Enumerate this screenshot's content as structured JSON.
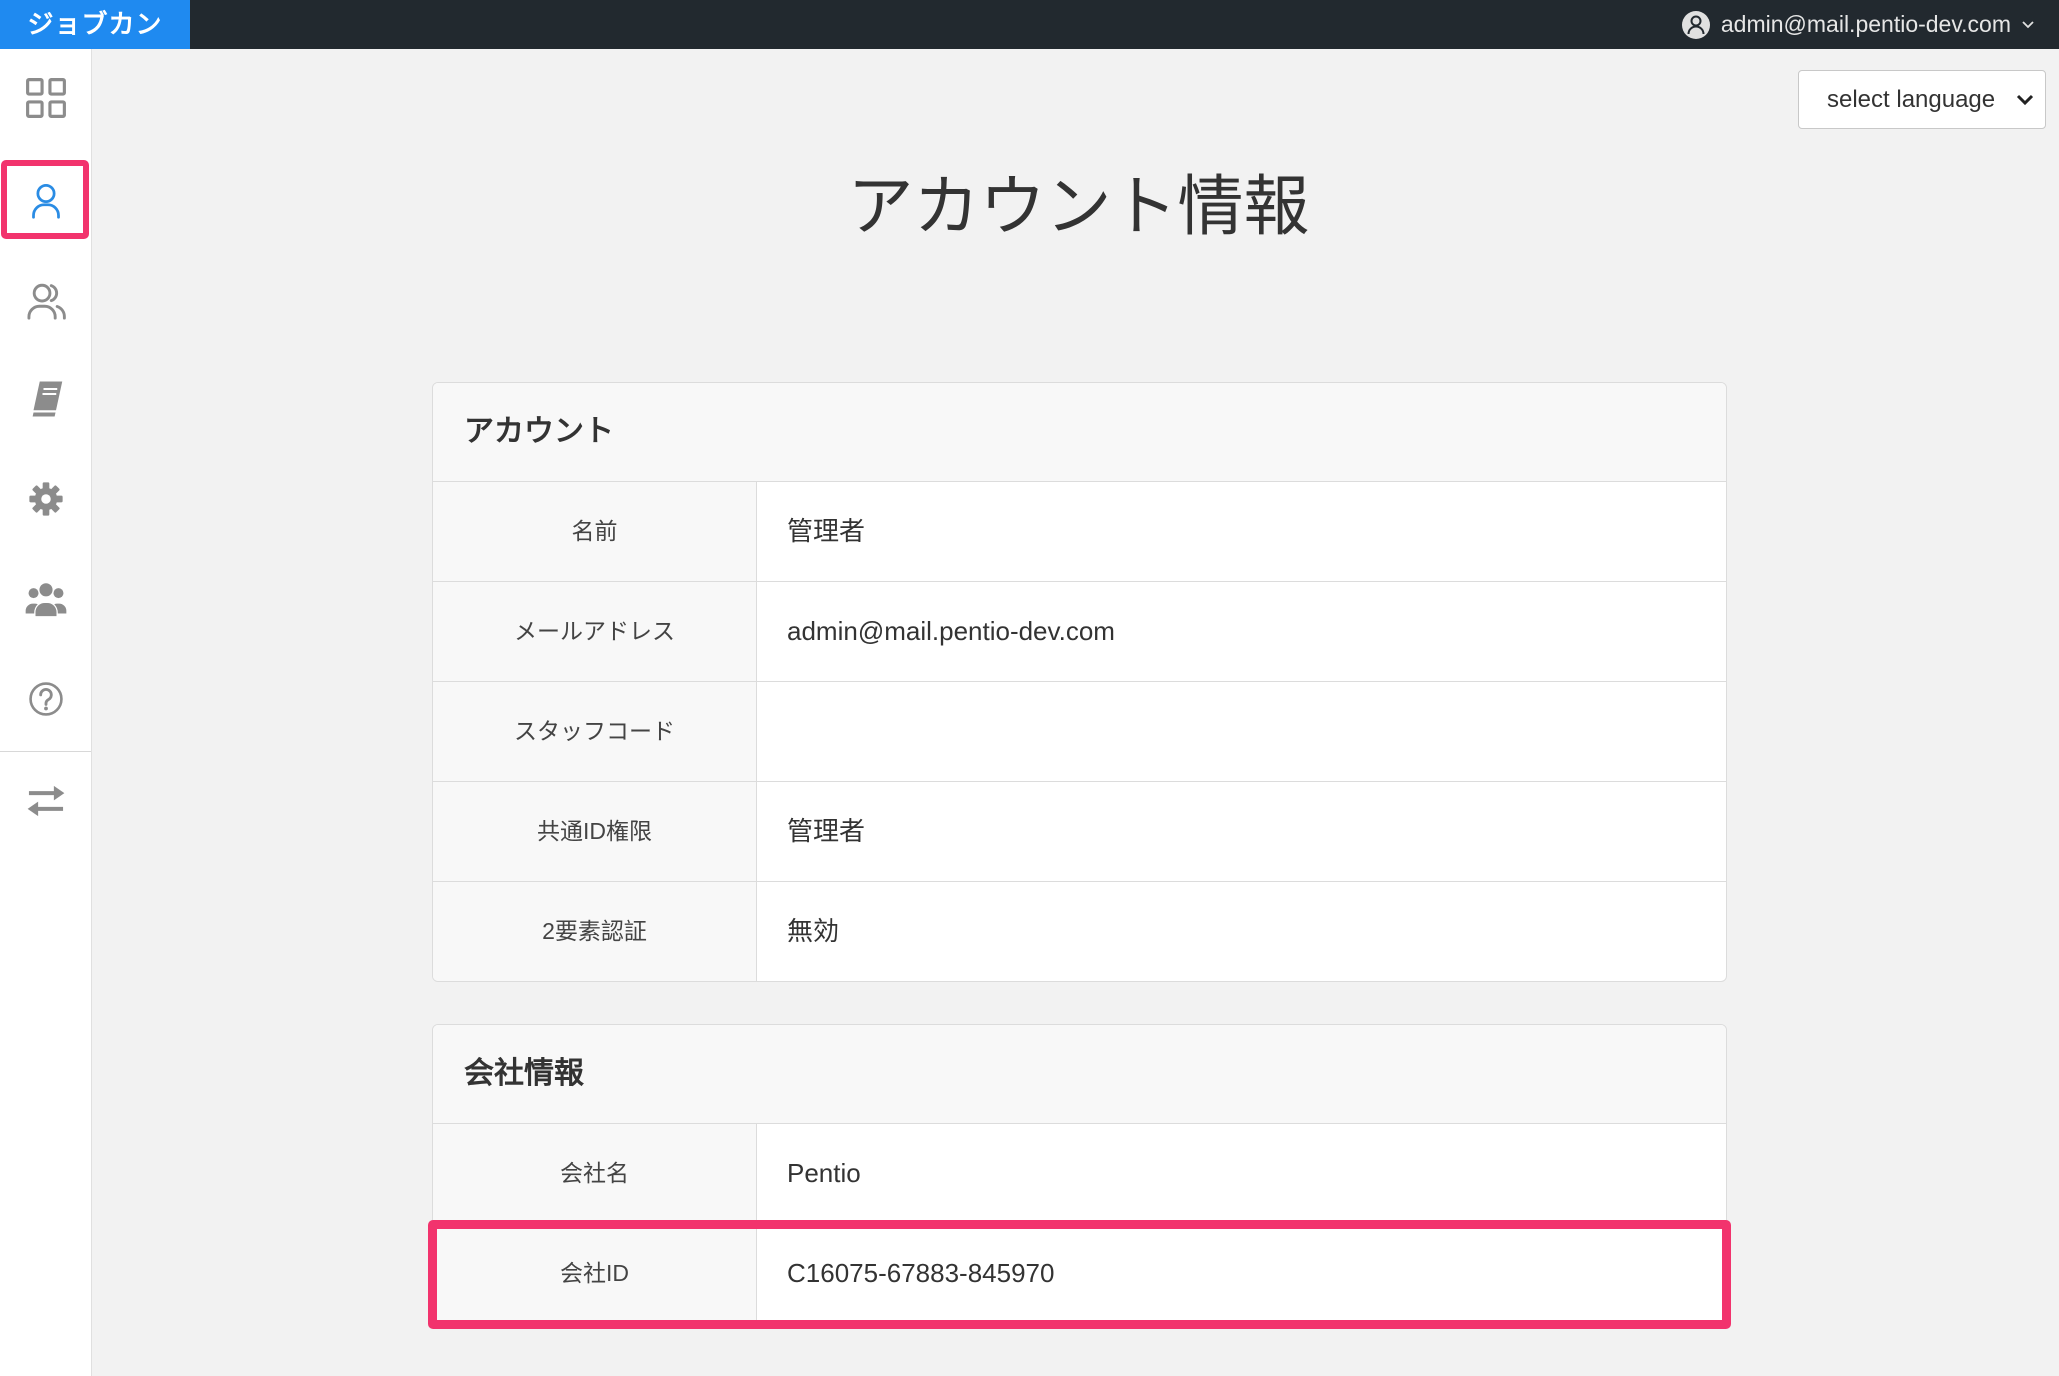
{
  "topbar": {
    "logo": "ジョブカン",
    "user_email": "admin@mail.pentio-dev.com",
    "avatar_icon": "user-circle-icon",
    "menu_icon": "chevron-down-icon"
  },
  "sidebar": {
    "items": [
      {
        "icon": "grid-icon",
        "active": false
      },
      {
        "icon": "user-icon",
        "active": true
      },
      {
        "icon": "users-icon",
        "active": false
      },
      {
        "icon": "book-icon",
        "active": false
      },
      {
        "icon": "gear-icon",
        "active": false
      },
      {
        "icon": "group-icon",
        "active": false
      },
      {
        "icon": "help-icon",
        "active": false
      },
      {
        "icon": "exchange-icon",
        "active": false
      }
    ]
  },
  "language_select": {
    "value": "select language",
    "icon": "chevron-down-icon"
  },
  "page": {
    "title": "アカウント情報"
  },
  "account": {
    "heading": "アカウント",
    "rows": [
      {
        "label": "名前",
        "value": "管理者"
      },
      {
        "label": "メールアドレス",
        "value": "admin@mail.pentio-dev.com"
      },
      {
        "label": "スタッフコード",
        "value": ""
      },
      {
        "label": "共通ID権限",
        "value": "管理者"
      },
      {
        "label": "2要素認証",
        "value": "無効"
      }
    ]
  },
  "company": {
    "heading": "会社情報",
    "rows": [
      {
        "label": "会社名",
        "value": "Pentio"
      },
      {
        "label": "会社ID",
        "value": "C16075-67883-845970"
      }
    ]
  },
  "colors": {
    "topbar": "#22292f",
    "logo_bg": "#1f8af0",
    "accent": "#2a8ce4",
    "highlight": "#f2336d",
    "page_bg": "#f2f2f2"
  }
}
